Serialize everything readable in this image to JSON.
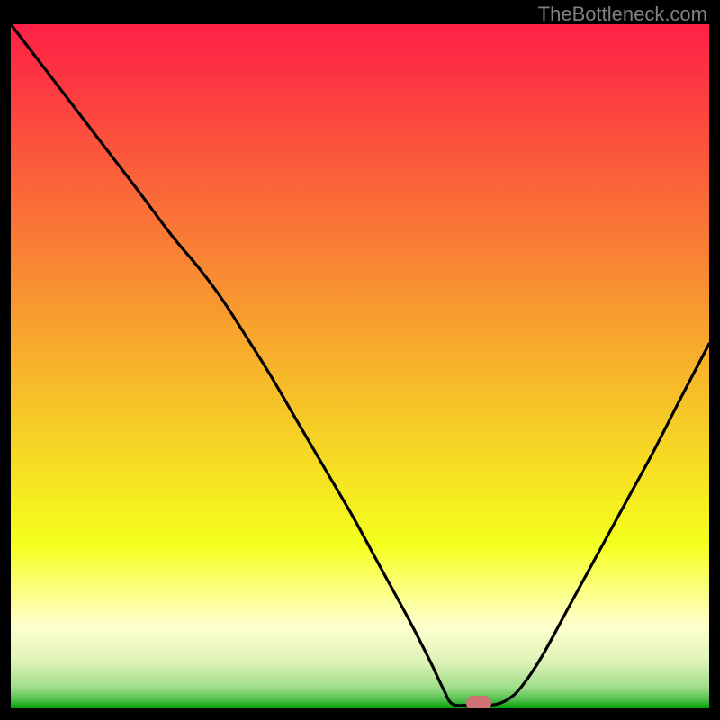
{
  "attribution": "TheBottleneck.com",
  "colors": {
    "gradient_stops": [
      {
        "offset": 0.0,
        "color": "#fd2146"
      },
      {
        "offset": 0.04,
        "color": "#fd2b44"
      },
      {
        "offset": 0.1,
        "color": "#fc3c41"
      },
      {
        "offset": 0.16,
        "color": "#fb4e3d"
      },
      {
        "offset": 0.22,
        "color": "#fa603a"
      },
      {
        "offset": 0.28,
        "color": "#fa7137"
      },
      {
        "offset": 0.34,
        "color": "#f98334"
      },
      {
        "offset": 0.4,
        "color": "#f89530"
      },
      {
        "offset": 0.46,
        "color": "#f8a72d"
      },
      {
        "offset": 0.52,
        "color": "#f7b92a"
      },
      {
        "offset": 0.58,
        "color": "#f6cb27"
      },
      {
        "offset": 0.64,
        "color": "#f6dc23"
      },
      {
        "offset": 0.7,
        "color": "#f5ee20"
      },
      {
        "offset": 0.76,
        "color": "#f4ff1d"
      },
      {
        "offset": 0.8,
        "color": "#f8ff58"
      },
      {
        "offset": 0.84,
        "color": "#fbff93"
      },
      {
        "offset": 0.88,
        "color": "#ffffcf"
      },
      {
        "offset": 0.93,
        "color": "#dff4b8"
      },
      {
        "offset": 0.97,
        "color": "#9fdd89"
      },
      {
        "offset": 0.988,
        "color": "#4fbd4a"
      },
      {
        "offset": 1.0,
        "color": "#00a104"
      }
    ],
    "curve_stroke": "#000000",
    "marker_fill": "#cf7373",
    "frame_background": "#000000",
    "attribution_color": "#808080"
  },
  "chart_data": {
    "type": "line",
    "title": "",
    "xlabel": "",
    "ylabel": "",
    "xlim": [
      0,
      100
    ],
    "ylim": [
      0,
      100
    ],
    "grid": false,
    "legend": false,
    "comment": "Percent-of-plot coordinates; origin top-left. A bottleneck-style curve descending from top-left, an inflection near x≈30, reaching a flat minimum around x≈63–69 then rising to the right.",
    "series": [
      {
        "name": "curve",
        "points": [
          {
            "x": 0.0,
            "y": 0.0
          },
          {
            "x": 6.0,
            "y": 8.0
          },
          {
            "x": 12.0,
            "y": 16.0
          },
          {
            "x": 18.0,
            "y": 24.0
          },
          {
            "x": 23.0,
            "y": 30.8
          },
          {
            "x": 27.0,
            "y": 35.7
          },
          {
            "x": 30.0,
            "y": 39.8
          },
          {
            "x": 33.0,
            "y": 44.5
          },
          {
            "x": 37.0,
            "y": 51.0
          },
          {
            "x": 41.0,
            "y": 58.0
          },
          {
            "x": 45.0,
            "y": 65.0
          },
          {
            "x": 49.0,
            "y": 72.0
          },
          {
            "x": 53.0,
            "y": 79.5
          },
          {
            "x": 57.0,
            "y": 87.0
          },
          {
            "x": 60.0,
            "y": 93.0
          },
          {
            "x": 62.0,
            "y": 97.3
          },
          {
            "x": 63.3,
            "y": 99.4
          },
          {
            "x": 66.0,
            "y": 99.5
          },
          {
            "x": 69.0,
            "y": 99.5
          },
          {
            "x": 71.0,
            "y": 98.8
          },
          {
            "x": 73.0,
            "y": 97.0
          },
          {
            "x": 76.0,
            "y": 92.5
          },
          {
            "x": 80.0,
            "y": 85.0
          },
          {
            "x": 84.0,
            "y": 77.5
          },
          {
            "x": 88.0,
            "y": 70.0
          },
          {
            "x": 92.0,
            "y": 62.5
          },
          {
            "x": 96.0,
            "y": 54.5
          },
          {
            "x": 100.0,
            "y": 46.7
          }
        ]
      }
    ],
    "marker": {
      "x": 67.0,
      "y": 99.2,
      "width_pct": 3.7,
      "height_pct": 2.0
    }
  }
}
